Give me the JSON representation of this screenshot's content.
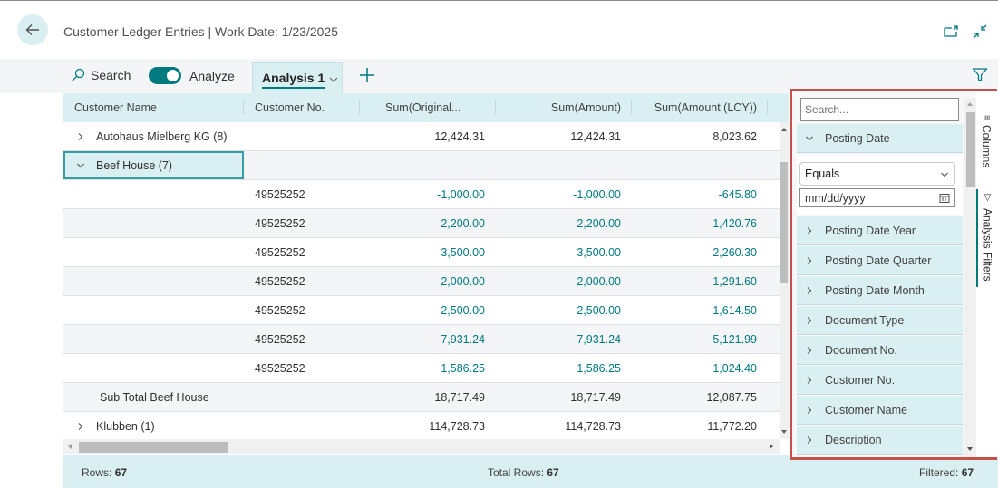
{
  "header": {
    "title": "Customer Ledger Entries | Work Date: 1/23/2025",
    "back_icon": "arrow-left-icon",
    "open_new_window_icon": "open-in-new-window-icon",
    "collapse_icon": "collapse-arrows-icon"
  },
  "actionbar": {
    "search_label": "Search",
    "analyze_label": "Analyze",
    "analyze_on": true,
    "tab_label": "Analysis 1",
    "add_icon": "plus-icon",
    "filter_icon": "filter-funnel-icon"
  },
  "grid": {
    "columns": [
      "Customer Name",
      "Customer No.",
      "Sum(Original...",
      "Sum(Amount)",
      "Sum(Amount (LCY))"
    ],
    "rows": [
      {
        "type": "group",
        "expanded": false,
        "name": "Autohaus Mielberg KG (8)",
        "no": "",
        "orig": "12,424.31",
        "amount": "12,424.31",
        "lcy": "8,023.62"
      },
      {
        "type": "group",
        "expanded": true,
        "name": "Beef House (7)",
        "no": "",
        "orig": "",
        "amount": "",
        "lcy": "",
        "selected": true
      },
      {
        "type": "detail",
        "name": "",
        "no": "49525252",
        "orig": "-1,000.00",
        "amount": "-1,000.00",
        "lcy": "-645.80"
      },
      {
        "type": "detail",
        "name": "",
        "no": "49525252",
        "orig": "2,200.00",
        "amount": "2,200.00",
        "lcy": "1,420.76"
      },
      {
        "type": "detail",
        "name": "",
        "no": "49525252",
        "orig": "3,500.00",
        "amount": "3,500.00",
        "lcy": "2,260.30"
      },
      {
        "type": "detail",
        "name": "",
        "no": "49525252",
        "orig": "2,000.00",
        "amount": "2,000.00",
        "lcy": "1,291.60"
      },
      {
        "type": "detail",
        "name": "",
        "no": "49525252",
        "orig": "2,500.00",
        "amount": "2,500.00",
        "lcy": "1,614.50"
      },
      {
        "type": "detail",
        "name": "",
        "no": "49525252",
        "orig": "7,931.24",
        "amount": "7,931.24",
        "lcy": "5,121.99"
      },
      {
        "type": "detail",
        "name": "",
        "no": "49525252",
        "orig": "1,586.25",
        "amount": "1,586.25",
        "lcy": "1,024.40"
      },
      {
        "type": "subtotal",
        "name": "Sub Total Beef House",
        "no": "",
        "orig": "18,717.49",
        "amount": "18,717.49",
        "lcy": "12,087.75"
      },
      {
        "type": "group",
        "expanded": false,
        "name": "Klubben (1)",
        "no": "",
        "orig": "114,728.73",
        "amount": "114,728.73",
        "lcy": "11,772.20"
      }
    ]
  },
  "footer": {
    "rows_label": "Rows:",
    "rows_value": "67",
    "total_label": "Total Rows:",
    "total_value": "67",
    "filtered_label": "Filtered:",
    "filtered_value": "67"
  },
  "filter_panel": {
    "search_placeholder": "Search...",
    "expanded_field": "Posting Date",
    "operator": "Equals",
    "date_placeholder": "mm/dd/yyyy",
    "fields": [
      "Posting Date Year",
      "Posting Date Quarter",
      "Posting Date Month",
      "Document Type",
      "Document No.",
      "Customer No.",
      "Customer Name",
      "Description"
    ],
    "side_tabs": [
      "Columns",
      "Analysis Filters"
    ]
  },
  "colors": {
    "accent": "#00797f",
    "header_bg": "#daeff2",
    "highlight_border": "#c8504a"
  }
}
